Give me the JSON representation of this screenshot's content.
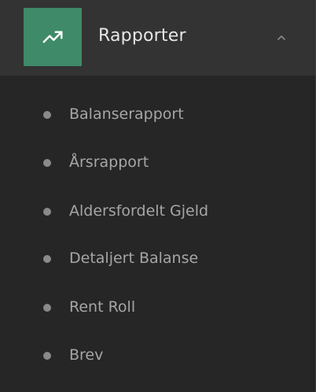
{
  "menu": {
    "title": "Rapporter",
    "icon": "trending-up-icon",
    "expanded_icon": "chevron-up-icon",
    "accent_color": "#3f8a68",
    "items": [
      {
        "label": "Balanserapport"
      },
      {
        "label": "Årsrapport"
      },
      {
        "label": "Aldersfordelt Gjeld"
      },
      {
        "label": "Detaljert Balanse"
      },
      {
        "label": "Rent Roll"
      },
      {
        "label": "Brev"
      }
    ]
  }
}
